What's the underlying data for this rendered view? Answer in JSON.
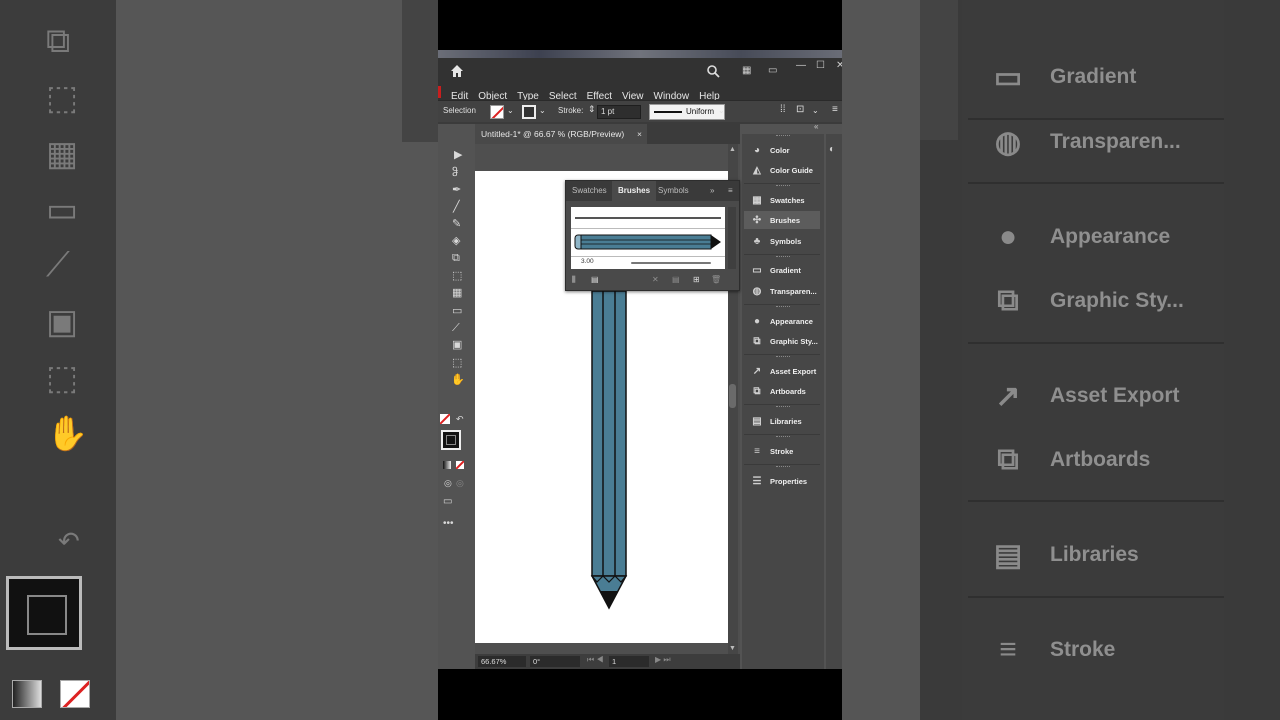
{
  "app": {
    "menus": [
      "Edit",
      "Object",
      "Type",
      "Select",
      "Effect",
      "View",
      "Window",
      "Help"
    ],
    "selection_label": "Selection",
    "stroke_label": "Stroke:",
    "stroke_weight": "1 pt",
    "profile": "Uniform"
  },
  "document": {
    "tab_title": "Untitled-1* @ 66.67 % (RGB/Preview)",
    "close": "×",
    "zoom": "66.67%",
    "rotation": "0°",
    "artboard_num": "1"
  },
  "brushes_panel": {
    "tabs": [
      "Swatches",
      "Brushes",
      "Symbols"
    ],
    "active_tab": "Brushes",
    "size_value": "3.00"
  },
  "dock": {
    "items": [
      {
        "label": "Color",
        "icon": "color-icon"
      },
      {
        "label": "Color Guide",
        "icon": "color-guide-icon"
      },
      {
        "label": "Swatches",
        "icon": "swatches-icon"
      },
      {
        "label": "Brushes",
        "icon": "brushes-icon"
      },
      {
        "label": "Symbols",
        "icon": "symbols-icon"
      },
      {
        "label": "Gradient",
        "icon": "gradient-icon"
      },
      {
        "label": "Transparen...",
        "icon": "transparency-icon"
      },
      {
        "label": "Appearance",
        "icon": "appearance-icon"
      },
      {
        "label": "Graphic Sty...",
        "icon": "graphic-styles-icon"
      },
      {
        "label": "Asset Export",
        "icon": "asset-export-icon"
      },
      {
        "label": "Artboards",
        "icon": "artboards-icon"
      },
      {
        "label": "Libraries",
        "icon": "libraries-icon"
      },
      {
        "label": "Stroke",
        "icon": "stroke-icon"
      },
      {
        "label": "Properties",
        "icon": "properties-icon"
      }
    ]
  },
  "background": {
    "items": [
      "Gradient",
      "Transparen...",
      "Appearance",
      "Graphic Sty...",
      "Asset Export",
      "Artboards",
      "Libraries",
      "Stroke"
    ]
  },
  "colors": {
    "pencil_body": "#4a7d94",
    "accent_red": "#d22222"
  }
}
